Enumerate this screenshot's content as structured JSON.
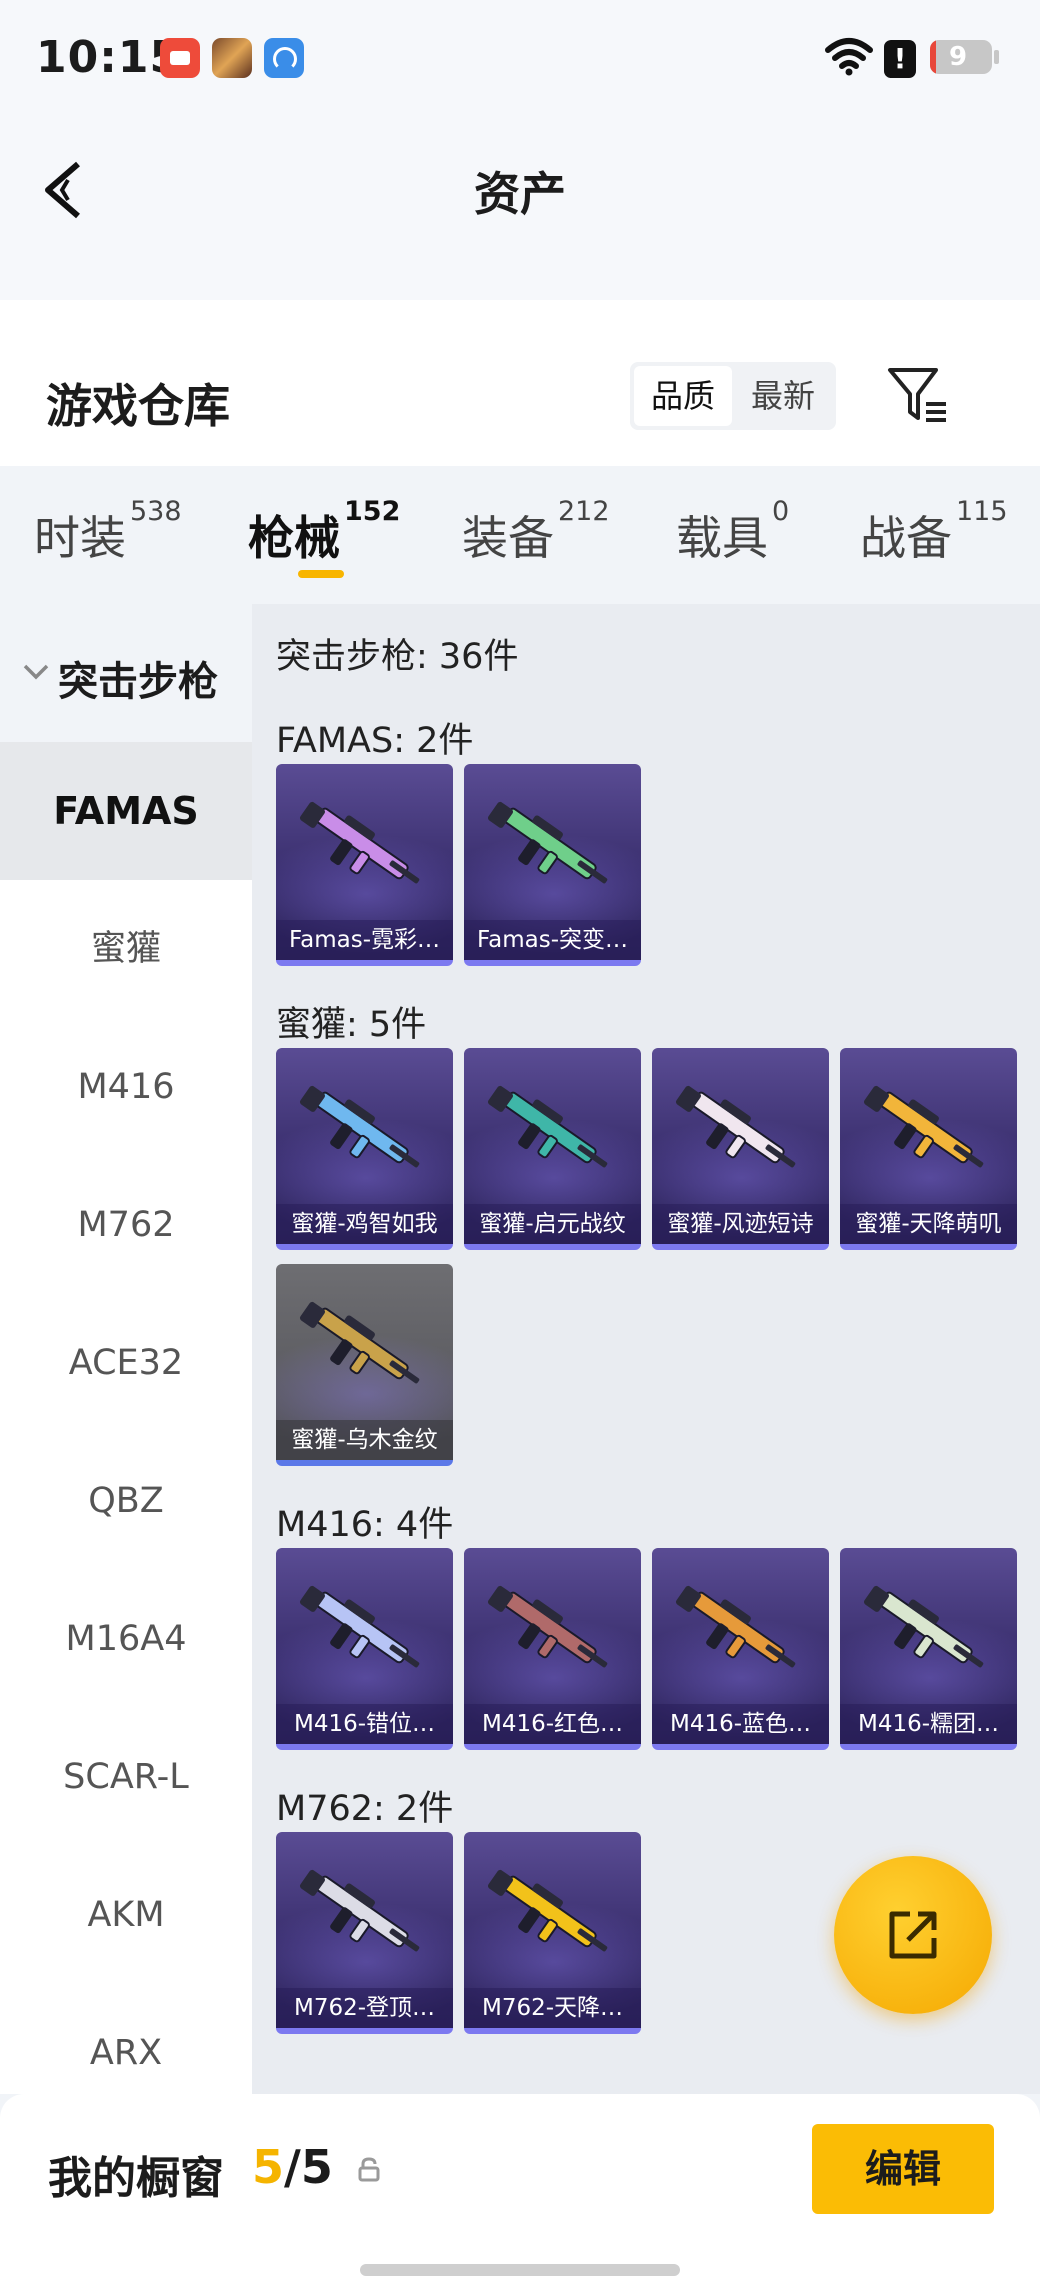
{
  "status_bar": {
    "time": "10:15",
    "battery_level": "9",
    "battery_fraction": 0.09
  },
  "header": {
    "title": "资产",
    "back_icon": "chevron-left-icon"
  },
  "warehouse": {
    "title": "游戏仓库",
    "sort_options": [
      "品质",
      "最新"
    ],
    "sort_selected": "品质",
    "filter_icon": "filter-icon"
  },
  "tabs": [
    {
      "label": "时装",
      "count": "538"
    },
    {
      "label": "枪械",
      "count": "152"
    },
    {
      "label": "装备",
      "count": "212"
    },
    {
      "label": "载具",
      "count": "0"
    },
    {
      "label": "战备",
      "count": "115"
    }
  ],
  "active_tab": "枪械",
  "sidebar": {
    "category": "突击步枪",
    "items": [
      "FAMAS",
      "蜜獾",
      "M416",
      "M762",
      "ACE32",
      "QBZ",
      "M16A4",
      "SCAR-L",
      "AKM",
      "ARX"
    ],
    "active_item": "FAMAS"
  },
  "content": {
    "category_title": "突击步枪: 36件",
    "groups": [
      {
        "title": "FAMAS: 2件",
        "items": [
          {
            "label": "Famas-霓彩…",
            "accent": "#c98de8",
            "grey": false
          },
          {
            "label": "Famas-突变…",
            "accent": "#6fcf8a",
            "grey": false
          }
        ]
      },
      {
        "title": "蜜獾: 5件",
        "items": [
          {
            "label": "蜜獾-鸡智如我",
            "accent": "#6fb8ef",
            "grey": false
          },
          {
            "label": "蜜獾-启元战纹",
            "accent": "#3fb6a8",
            "grey": false
          },
          {
            "label": "蜜獾-风迹短诗",
            "accent": "#f0e6ef",
            "grey": false
          },
          {
            "label": "蜜獾-天降萌叽",
            "accent": "#f2b53a",
            "grey": false
          },
          {
            "label": "蜜獾-乌木金纹",
            "accent": "#c9a24a",
            "grey": true
          }
        ]
      },
      {
        "title": "M416: 4件",
        "items": [
          {
            "label": "M416-错位…",
            "accent": "#b7c4f5",
            "grey": false
          },
          {
            "label": "M416-红色…",
            "accent": "#b06a6a",
            "grey": false
          },
          {
            "label": "M416-蓝色…",
            "accent": "#e69a3a",
            "grey": false
          },
          {
            "label": "M416-糯团…",
            "accent": "#d9e6cf",
            "grey": false
          }
        ]
      },
      {
        "title": "M762: 2件",
        "items": [
          {
            "label": "M762-登顶…",
            "accent": "#dcdce6",
            "grey": false
          },
          {
            "label": "M762-天降…",
            "accent": "#f2c21a",
            "grey": false
          }
        ]
      }
    ]
  },
  "fab_icon": "share-external-icon",
  "bottom_bar": {
    "title": "我的橱窗",
    "count_current": "5",
    "count_separator": "/",
    "count_total": "5",
    "lock_icon": "lock-icon",
    "edit_label": "编辑"
  }
}
